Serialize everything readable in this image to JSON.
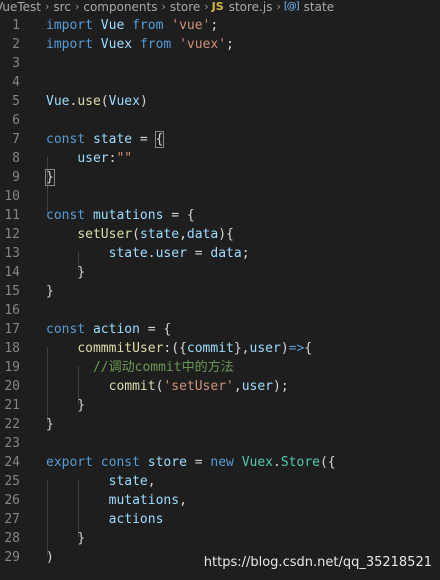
{
  "breadcrumb": {
    "items": [
      "VueTest",
      "src",
      "components",
      "store",
      "store.js",
      "state"
    ],
    "js_badge": "JS",
    "symbol_icon": "[@]"
  },
  "editor": {
    "lines": [
      {
        "n": "1",
        "tokens": [
          [
            "kw",
            "import"
          ],
          [
            "op",
            " "
          ],
          [
            "var",
            "Vue"
          ],
          [
            "op",
            " "
          ],
          [
            "kw",
            "from"
          ],
          [
            "op",
            " "
          ],
          [
            "str",
            "'vue'"
          ],
          [
            "op",
            ";"
          ]
        ]
      },
      {
        "n": "2",
        "tokens": [
          [
            "kw",
            "import"
          ],
          [
            "op",
            " "
          ],
          [
            "var",
            "Vuex"
          ],
          [
            "op",
            " "
          ],
          [
            "kw",
            "from"
          ],
          [
            "op",
            " "
          ],
          [
            "str",
            "'vuex'"
          ],
          [
            "op",
            ";"
          ]
        ]
      },
      {
        "n": "3",
        "tokens": []
      },
      {
        "n": "4",
        "tokens": []
      },
      {
        "n": "5",
        "tokens": [
          [
            "var",
            "Vue"
          ],
          [
            "op",
            "."
          ],
          [
            "fn",
            "use"
          ],
          [
            "op",
            "("
          ],
          [
            "var",
            "Vuex"
          ],
          [
            "op",
            ")"
          ]
        ]
      },
      {
        "n": "6",
        "tokens": []
      },
      {
        "n": "7",
        "tokens": [
          [
            "kw",
            "const"
          ],
          [
            "op",
            " "
          ],
          [
            "var",
            "state"
          ],
          [
            "op",
            " = "
          ],
          [
            "hl",
            "{"
          ]
        ]
      },
      {
        "n": "8",
        "tokens": [
          [
            "op",
            "    "
          ],
          [
            "var",
            "user"
          ],
          [
            "op",
            ":"
          ],
          [
            "str",
            "\"\""
          ]
        ]
      },
      {
        "n": "9",
        "tokens": [
          [
            "hl",
            "}"
          ]
        ]
      },
      {
        "n": "10",
        "tokens": []
      },
      {
        "n": "11",
        "tokens": [
          [
            "kw",
            "const"
          ],
          [
            "op",
            " "
          ],
          [
            "var",
            "mutations"
          ],
          [
            "op",
            " = {"
          ]
        ]
      },
      {
        "n": "12",
        "tokens": [
          [
            "op",
            "    "
          ],
          [
            "fn",
            "setUser"
          ],
          [
            "op",
            "("
          ],
          [
            "var",
            "state"
          ],
          [
            "op",
            ","
          ],
          [
            "var",
            "data"
          ],
          [
            "op",
            "){"
          ]
        ]
      },
      {
        "n": "13",
        "tokens": [
          [
            "op",
            "        "
          ],
          [
            "var",
            "state"
          ],
          [
            "op",
            "."
          ],
          [
            "var",
            "user"
          ],
          [
            "op",
            " = "
          ],
          [
            "var",
            "data"
          ],
          [
            "op",
            ";"
          ]
        ]
      },
      {
        "n": "14",
        "tokens": [
          [
            "op",
            "    }"
          ]
        ]
      },
      {
        "n": "15",
        "tokens": [
          [
            "op",
            "}"
          ]
        ]
      },
      {
        "n": "16",
        "tokens": []
      },
      {
        "n": "17",
        "tokens": [
          [
            "kw",
            "const"
          ],
          [
            "op",
            " "
          ],
          [
            "var",
            "action"
          ],
          [
            "op",
            " = {"
          ]
        ]
      },
      {
        "n": "18",
        "tokens": [
          [
            "op",
            "    "
          ],
          [
            "fn",
            "commmitUser"
          ],
          [
            "op",
            ":({"
          ],
          [
            "var",
            "commit"
          ],
          [
            "op",
            "},"
          ],
          [
            "var",
            "user"
          ],
          [
            "op",
            ")"
          ],
          [
            "kw",
            "=>"
          ],
          [
            "op",
            "{"
          ]
        ]
      },
      {
        "n": "19",
        "tokens": [
          [
            "op",
            "      "
          ],
          [
            "cm",
            "//调动commit中的方法"
          ]
        ]
      },
      {
        "n": "20",
        "tokens": [
          [
            "op",
            "        "
          ],
          [
            "fn",
            "commit"
          ],
          [
            "op",
            "("
          ],
          [
            "str",
            "'setUser'"
          ],
          [
            "op",
            ","
          ],
          [
            "var",
            "user"
          ],
          [
            "op",
            ");"
          ]
        ]
      },
      {
        "n": "21",
        "tokens": [
          [
            "op",
            "    }"
          ]
        ]
      },
      {
        "n": "22",
        "tokens": [
          [
            "op",
            "}"
          ]
        ]
      },
      {
        "n": "23",
        "tokens": []
      },
      {
        "n": "24",
        "tokens": [
          [
            "kw",
            "export"
          ],
          [
            "op",
            " "
          ],
          [
            "kw",
            "const"
          ],
          [
            "op",
            " "
          ],
          [
            "var",
            "store"
          ],
          [
            "op",
            " = "
          ],
          [
            "kw",
            "new"
          ],
          [
            "op",
            " "
          ],
          [
            "cls",
            "Vuex"
          ],
          [
            "op",
            "."
          ],
          [
            "cls",
            "Store"
          ],
          [
            "op",
            "({"
          ]
        ]
      },
      {
        "n": "25",
        "tokens": [
          [
            "op",
            "        "
          ],
          [
            "var",
            "state"
          ],
          [
            "op",
            ","
          ]
        ]
      },
      {
        "n": "26",
        "tokens": [
          [
            "op",
            "        "
          ],
          [
            "var",
            "mutations"
          ],
          [
            "op",
            ","
          ]
        ]
      },
      {
        "n": "27",
        "tokens": [
          [
            "op",
            "        "
          ],
          [
            "var",
            "actions"
          ]
        ]
      },
      {
        "n": "28",
        "tokens": [
          [
            "op",
            "    }"
          ]
        ]
      },
      {
        "n": "29",
        "tokens": [
          [
            "op",
            ")"
          ]
        ]
      }
    ]
  },
  "watermark": "https://blog.csdn.net/qq_35218521"
}
